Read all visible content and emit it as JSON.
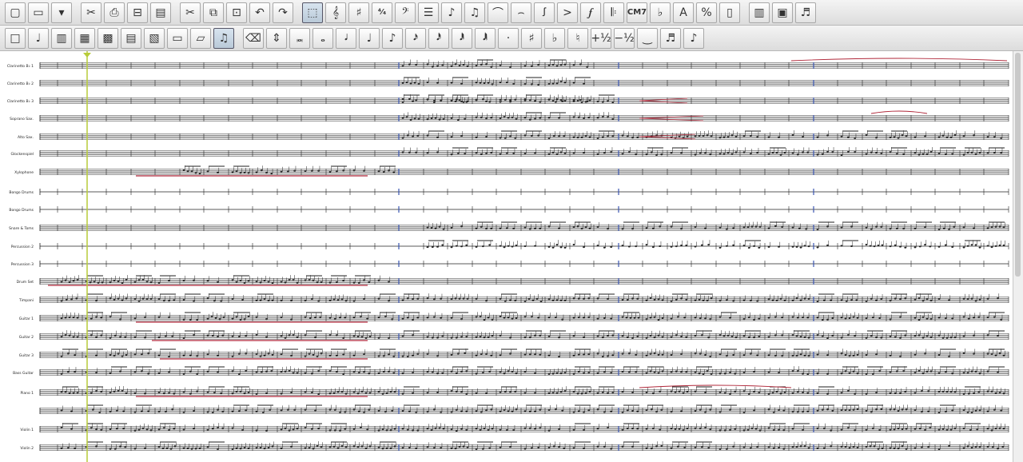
{
  "toolbar1": {
    "buttons": [
      {
        "name": "new-document",
        "icon": "▢"
      },
      {
        "name": "open-folder",
        "icon": "▭"
      },
      {
        "name": "open-menu",
        "icon": "▾"
      },
      {
        "name": "cut-disabled",
        "icon": "✂"
      },
      {
        "name": "print",
        "icon": "⎙"
      },
      {
        "name": "page-view",
        "icon": "⊟"
      },
      {
        "name": "library",
        "icon": "▤"
      },
      {
        "name": "scissors",
        "icon": "✂"
      },
      {
        "name": "copy",
        "icon": "⧉"
      },
      {
        "name": "paste",
        "icon": "⊡"
      },
      {
        "name": "undo",
        "icon": "↶"
      },
      {
        "name": "redo",
        "icon": "↷"
      },
      {
        "name": "selection-tool",
        "icon": "⬚"
      },
      {
        "name": "clef-tool",
        "icon": "𝄞"
      },
      {
        "name": "key-signature",
        "icon": "♯"
      },
      {
        "name": "time-signature",
        "icon": "⁴⁄₄"
      },
      {
        "name": "bass-clef",
        "icon": "𝄢"
      },
      {
        "name": "staff",
        "icon": "☰"
      },
      {
        "name": "note-entry",
        "icon": "♪"
      },
      {
        "name": "speedy-entry",
        "icon": "♫"
      },
      {
        "name": "tuplet",
        "icon": "⌒"
      },
      {
        "name": "tie",
        "icon": "⌢"
      },
      {
        "name": "expression",
        "icon": "ꭍ"
      },
      {
        "name": "articulation",
        "icon": ">"
      },
      {
        "name": "dynamic",
        "icon": "𝆑"
      },
      {
        "name": "repeat",
        "icon": "𝄆"
      },
      {
        "name": "chord",
        "icon": "CM7"
      },
      {
        "name": "lyrics",
        "icon": "♭"
      },
      {
        "name": "text",
        "icon": "A"
      },
      {
        "name": "resize",
        "icon": "%"
      },
      {
        "name": "page-layout",
        "icon": "▯"
      },
      {
        "name": "special-tools",
        "icon": "▥"
      },
      {
        "name": "graphics",
        "icon": "▣"
      },
      {
        "name": "mixer",
        "icon": "♬"
      }
    ]
  },
  "toolbar2": {
    "buttons": [
      {
        "name": "simple-entry",
        "icon": "□"
      },
      {
        "name": "hyperscribe",
        "icon": "♩"
      },
      {
        "name": "measure",
        "icon": "▥"
      },
      {
        "name": "grid",
        "icon": "▦"
      },
      {
        "name": "page-grid",
        "icon": "▩"
      },
      {
        "name": "score-manager",
        "icon": "▤"
      },
      {
        "name": "print-preview",
        "icon": "▧"
      },
      {
        "name": "page",
        "icon": "▭"
      },
      {
        "name": "note-sheet",
        "icon": "▱"
      },
      {
        "name": "playback",
        "icon": "♫"
      },
      {
        "name": "eraser",
        "icon": "⌫"
      },
      {
        "name": "stepper",
        "icon": "⇕"
      },
      {
        "name": "double-whole",
        "icon": "𝅜"
      },
      {
        "name": "whole-note",
        "icon": "𝅝"
      },
      {
        "name": "half-note",
        "icon": "𝅗𝅥"
      },
      {
        "name": "quarter-note",
        "icon": "♩"
      },
      {
        "name": "eighth-note",
        "icon": "♪"
      },
      {
        "name": "sixteenth-note",
        "icon": "𝅘𝅥𝅯"
      },
      {
        "name": "thirty-second",
        "icon": "𝅘𝅥𝅰"
      },
      {
        "name": "sixty-fourth",
        "icon": "𝅘𝅥𝅱"
      },
      {
        "name": "one-twenty-eighth",
        "icon": "𝅘𝅥𝅲"
      },
      {
        "name": "dot",
        "icon": "·"
      },
      {
        "name": "sharp",
        "icon": "♯"
      },
      {
        "name": "flat",
        "icon": "♭"
      },
      {
        "name": "natural",
        "icon": "♮"
      },
      {
        "name": "half-step-up",
        "icon": "+½"
      },
      {
        "name": "half-step-down",
        "icon": "−½"
      },
      {
        "name": "tie-entry",
        "icon": "‿"
      },
      {
        "name": "tuplet-entry",
        "icon": "♬"
      },
      {
        "name": "grace-note",
        "icon": "♪"
      }
    ]
  },
  "staves": [
    "Clarinetto B♭ 1",
    "Clarinetto B♭ 2",
    "Clarinetto B♭ 3",
    "Soprano Sax.",
    "Alto Sax.",
    "Glockenspiel",
    "Xylophone",
    "Bongo Drums",
    "Bongo Drums",
    "Snare & Toms",
    "Percussion 2",
    "Percussion 3",
    "Drum Set",
    "Timpani",
    "Guitar 1",
    "Guitar 2",
    "Guitar 3",
    "Bass Guitar",
    "Piano 1",
    "",
    "Violin 1",
    "Violin 2"
  ],
  "staff_label_short": [
    "Clarinetto B♭1",
    "Clarinetto B♭2",
    "Clarinetto B♭3",
    "Soprano Sax.",
    "Alto Sax.",
    "Glockenspiel",
    "Xylophone",
    "Bongo Drums",
    "Bongo Drums",
    "Snare\n& Toms",
    "Percussion 2",
    "Percussion 3",
    "Drum Set",
    "Timpani",
    "Guitar 1",
    "Guitar 2",
    "Guitar 3",
    "Bass Guitar",
    "Piano 1",
    "",
    "Violin 1",
    "Violin 2"
  ],
  "colors": {
    "ink": "#222222",
    "annotation": "#b0283a",
    "playback_line": "#b8cc3a",
    "barline_accent": "#3a55b0"
  }
}
